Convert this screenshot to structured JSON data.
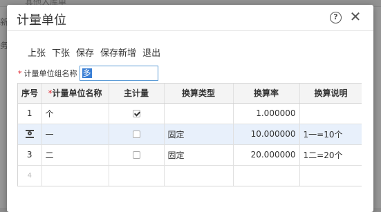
{
  "background": {
    "tab_text": "其他入库单",
    "left_texts": [
      "新",
      "务"
    ]
  },
  "dialog": {
    "title": "计量单位",
    "help_symbol": "?",
    "close_symbol": "✕"
  },
  "toolbar": {
    "buttons": [
      "上张",
      "下张",
      "保存",
      "保存新增",
      "退出"
    ]
  },
  "group_field": {
    "required_mark": "*",
    "label": "计量单位组名称",
    "value": "多"
  },
  "grid": {
    "columns": [
      "序号",
      "计量单位名称",
      "主计量",
      "换算类型",
      "换算率",
      "换算说明"
    ],
    "required_mark": "*",
    "rows": [
      {
        "index": "1",
        "name": "个",
        "is_main": true,
        "conversion_type": "",
        "rate": "1.000000",
        "description": ""
      },
      {
        "index": "",
        "name": "一",
        "is_main": false,
        "conversion_type": "固定",
        "rate": "10.000000",
        "description": "1一=10个"
      },
      {
        "index": "3",
        "name": "二",
        "is_main": false,
        "conversion_type": "固定",
        "rate": "20.000000",
        "description": "1二=20个"
      },
      {
        "index": "4",
        "name": "",
        "is_main": null,
        "conversion_type": "",
        "rate": "",
        "description": ""
      }
    ]
  },
  "colors": {
    "selected_row": "#e8f0fb",
    "input_border": "#5b9bd5",
    "required": "#e0202a"
  }
}
